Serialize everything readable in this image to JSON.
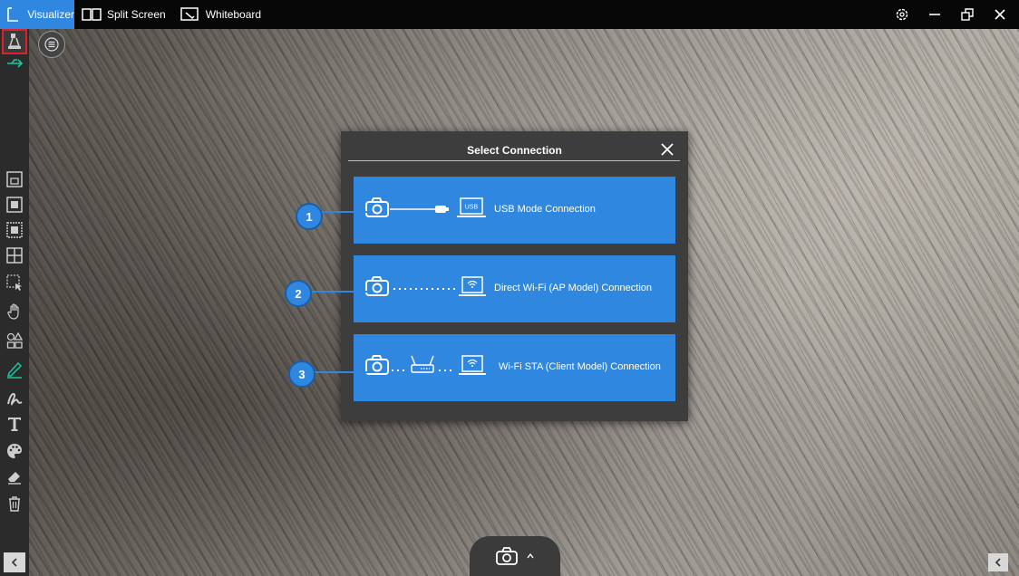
{
  "topbar": {
    "tabs": [
      {
        "label": "Visualizer",
        "icon": "visualizer-icon"
      },
      {
        "label": "Split Screen",
        "icon": "split-screen-icon"
      },
      {
        "label": "Whiteboard",
        "icon": "whiteboard-icon"
      }
    ],
    "controls": [
      "settings-icon",
      "minimize-icon",
      "restore-icon",
      "close-icon"
    ]
  },
  "toolbar": {
    "tools": [
      "camera-source-icon",
      "usb-icon",
      "fit-window-icon",
      "full-screen-icon",
      "freeze-icon",
      "split-view-icon",
      "select-area-icon",
      "pan-hand-icon",
      "shapes-icon",
      "pen-icon",
      "freehand-icon",
      "text-icon",
      "color-palette-icon",
      "eraser-icon",
      "trash-icon"
    ]
  },
  "dialog": {
    "title": "Select Connection",
    "options": [
      {
        "number": "1",
        "label": "USB Mode Connection",
        "badge_text": "USB"
      },
      {
        "number": "2",
        "label": "Direct Wi-Fi (AP Model) Connection"
      },
      {
        "number": "3",
        "label": "Wi-Fi STA (Client Model) Connection"
      }
    ]
  },
  "colors": {
    "accent": "#2f87e0",
    "active_outline": "#e0202a",
    "toolbar_bg": "#2b2b2b",
    "dialog_bg": "#3d3d3d"
  }
}
